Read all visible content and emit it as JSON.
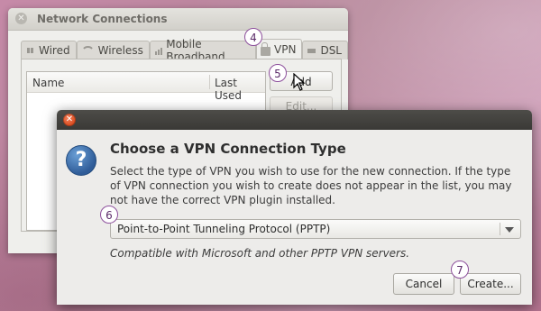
{
  "network_window": {
    "title": "Network Connections",
    "tabs": [
      {
        "label": "Wired",
        "icon": "wired-icon"
      },
      {
        "label": "Wireless",
        "icon": "wireless-icon"
      },
      {
        "label": "Mobile Broadband",
        "icon": "mobile-broadband-icon"
      },
      {
        "label": "VPN",
        "icon": "lock-icon",
        "active": true
      },
      {
        "label": "DSL",
        "icon": "dsl-icon"
      }
    ],
    "list_columns": [
      "Name",
      "Last Used"
    ],
    "buttons": {
      "add": "Add",
      "edit": "Edit..."
    }
  },
  "dialog": {
    "heading": "Choose a VPN Connection Type",
    "description": "Select the type of VPN you wish to use for the new connection.  If the type of VPN connection you wish to create does not appear in the list, you may not have the correct VPN plugin installed.",
    "vpn_type": {
      "selected": "Point-to-Point Tunneling Protocol (PPTP)"
    },
    "compat_note": "Compatible with Microsoft and other PPTP VPN servers.",
    "buttons": {
      "cancel": "Cancel",
      "create": "Create..."
    }
  },
  "callouts": [
    "4",
    "5",
    "6",
    "7"
  ],
  "colors": {
    "callout_border": "#8d4f9c",
    "close_button": "#d94a1e"
  }
}
